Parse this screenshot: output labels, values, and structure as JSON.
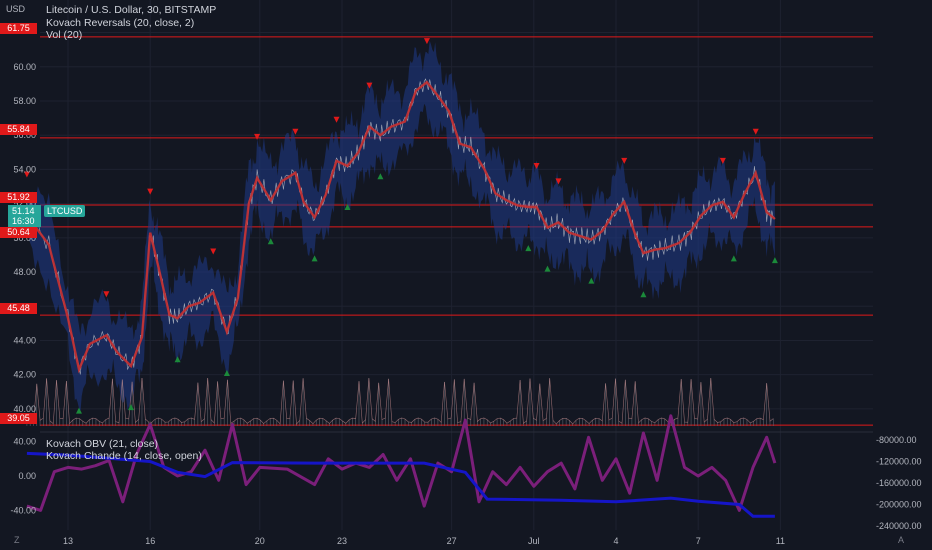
{
  "title": "Litecoin / U.S. Dollar, 30, BITSTAMP",
  "currency": "USD",
  "indicators": [
    "Kovach Reversals (20, close, 2)",
    "Vol (20)"
  ],
  "lower_indicators": [
    "Kovach OBV (21, close)",
    "Kovach Chande (14, close, open)"
  ],
  "symbol_tag": "LTCUSD",
  "last_price": "51.14",
  "countdown": "16:30",
  "horizontal_lines": [
    "61.75",
    "55.84",
    "51.92",
    "50.64",
    "45.48",
    "39.05"
  ],
  "price_axis_ticks": [
    "60.00",
    "58.00",
    "56.00",
    "54.00",
    "52.00",
    "50.00",
    "48.00",
    "46.00",
    "44.00",
    "42.00",
    "40.00"
  ],
  "osc_left_ticks": [
    "40.00",
    "0.00",
    "-40.00"
  ],
  "osc_right_ticks": [
    "-80000.00",
    "-120000.00",
    "-160000.00",
    "-200000.00",
    "-240000.00"
  ],
  "time_ticks": [
    "13",
    "16",
    "20",
    "23",
    "27",
    "Jul",
    "4",
    "7",
    "11"
  ],
  "corner_left": "Z",
  "corner_right": "A",
  "colors": {
    "background": "#131722",
    "hline": "#e0191a",
    "band": "#1f3a8a",
    "ma": "#c83030",
    "up_marker": "#1b8a3a",
    "down_marker": "#e0191a",
    "chande": "#7b1f7a",
    "obv": "#1515c8",
    "symbol_tag": "#26a69a"
  },
  "chart_data": {
    "type": "line",
    "title": "Litecoin / U.S. Dollar, 30, BITSTAMP",
    "ylabel": "USD",
    "ylim": [
      39.0,
      62.5
    ],
    "x": [
      "13",
      "16",
      "20",
      "23",
      "27",
      "Jul",
      "4",
      "7",
      "11"
    ],
    "series": [
      {
        "name": "LTCUSD",
        "points": [
          [
            11.5,
            51.3
          ],
          [
            12.3,
            49.6
          ],
          [
            13.0,
            45.3
          ],
          [
            13.4,
            42.3
          ],
          [
            13.8,
            43.8
          ],
          [
            14.4,
            44.3
          ],
          [
            14.8,
            43.3
          ],
          [
            15.3,
            42.5
          ],
          [
            15.7,
            44.2
          ],
          [
            16.0,
            50.3
          ],
          [
            16.3,
            48.3
          ],
          [
            16.7,
            45.5
          ],
          [
            17.0,
            45.3
          ],
          [
            17.4,
            46.0
          ],
          [
            17.8,
            46.2
          ],
          [
            18.3,
            46.8
          ],
          [
            18.8,
            44.5
          ],
          [
            19.2,
            46.5
          ],
          [
            19.6,
            52.0
          ],
          [
            19.9,
            53.5
          ],
          [
            20.4,
            52.2
          ],
          [
            20.8,
            53.3
          ],
          [
            21.3,
            53.8
          ],
          [
            21.6,
            52.1
          ],
          [
            22.0,
            51.2
          ],
          [
            22.4,
            52.5
          ],
          [
            22.8,
            54.5
          ],
          [
            23.2,
            54.2
          ],
          [
            23.6,
            55.0
          ],
          [
            24.0,
            56.5
          ],
          [
            24.4,
            56.0
          ],
          [
            24.8,
            56.5
          ],
          [
            25.3,
            56.8
          ],
          [
            25.7,
            58.6
          ],
          [
            26.1,
            59.1
          ],
          [
            26.5,
            58.3
          ],
          [
            26.9,
            57.4
          ],
          [
            27.3,
            55.5
          ],
          [
            27.7,
            55.3
          ],
          [
            28.2,
            54.0
          ],
          [
            28.6,
            52.6
          ],
          [
            29.0,
            52.2
          ],
          [
            29.4,
            51.9
          ],
          [
            29.8,
            51.8
          ],
          [
            30.1,
            51.8
          ],
          [
            30.5,
            50.6
          ],
          [
            30.9,
            50.9
          ],
          [
            31.3,
            50.3
          ],
          [
            31.7,
            50.1
          ],
          [
            32.1,
            49.9
          ],
          [
            32.5,
            50.4
          ],
          [
            32.9,
            51.4
          ],
          [
            33.3,
            52.1
          ],
          [
            33.7,
            50.2
          ],
          [
            34.0,
            49.1
          ],
          [
            34.4,
            49.3
          ],
          [
            34.8,
            49.4
          ],
          [
            35.3,
            49.7
          ],
          [
            35.7,
            50.3
          ],
          [
            36.1,
            51.3
          ],
          [
            36.5,
            51.9
          ],
          [
            36.9,
            52.1
          ],
          [
            37.3,
            51.2
          ],
          [
            37.7,
            52.6
          ],
          [
            38.1,
            53.8
          ],
          [
            38.5,
            51.5
          ],
          [
            38.8,
            51.1
          ]
        ]
      },
      {
        "name": "Kovach OBV (21, close)",
        "points": [
          [
            11.5,
            -105000
          ],
          [
            13.0,
            -108000
          ],
          [
            16.0,
            -120000
          ],
          [
            17.0,
            -140000
          ],
          [
            18.0,
            -148000
          ],
          [
            19.0,
            -122000
          ],
          [
            22.0,
            -123000
          ],
          [
            26.0,
            -123000
          ],
          [
            27.5,
            -140000
          ],
          [
            28.3,
            -190000
          ],
          [
            31.0,
            -192000
          ],
          [
            33.0,
            -195000
          ],
          [
            35.0,
            -188000
          ],
          [
            36.0,
            -194000
          ],
          [
            37.5,
            -200000
          ],
          [
            38.0,
            -222000
          ],
          [
            38.8,
            -222000
          ]
        ]
      },
      {
        "name": "Kovach Chande (14, close, open)",
        "points": [
          [
            11.5,
            -35
          ],
          [
            12.0,
            -40
          ],
          [
            12.5,
            5
          ],
          [
            13.0,
            10
          ],
          [
            13.5,
            8
          ],
          [
            14.0,
            12
          ],
          [
            14.5,
            18
          ],
          [
            15.0,
            -30
          ],
          [
            15.5,
            25
          ],
          [
            16.0,
            60
          ],
          [
            16.5,
            10
          ],
          [
            17.0,
            0
          ],
          [
            17.5,
            5
          ],
          [
            18.0,
            30
          ],
          [
            18.5,
            -5
          ],
          [
            19.0,
            60
          ],
          [
            19.5,
            -10
          ],
          [
            20.0,
            10
          ],
          [
            21.0,
            8
          ],
          [
            22.0,
            -10
          ],
          [
            22.5,
            20
          ],
          [
            23.0,
            8
          ],
          [
            23.5,
            15
          ],
          [
            24.0,
            10
          ],
          [
            24.5,
            25
          ],
          [
            25.0,
            -5
          ],
          [
            25.5,
            20
          ],
          [
            26.0,
            -35
          ],
          [
            26.5,
            15
          ],
          [
            27.0,
            5
          ],
          [
            27.5,
            65
          ],
          [
            28.0,
            -30
          ],
          [
            28.5,
            5
          ],
          [
            29.0,
            -10
          ],
          [
            29.5,
            10
          ],
          [
            30.0,
            -12
          ],
          [
            30.5,
            5
          ],
          [
            31.0,
            15
          ],
          [
            31.5,
            -15
          ],
          [
            32.0,
            45
          ],
          [
            32.5,
            -5
          ],
          [
            33.0,
            20
          ],
          [
            33.5,
            -20
          ],
          [
            34.0,
            50
          ],
          [
            34.5,
            -5
          ],
          [
            35.0,
            70
          ],
          [
            35.5,
            10
          ],
          [
            36.0,
            0
          ],
          [
            36.5,
            10
          ],
          [
            37.0,
            -5
          ],
          [
            37.5,
            -40
          ],
          [
            38.0,
            10
          ],
          [
            38.5,
            45
          ],
          [
            38.8,
            15
          ]
        ]
      }
    ],
    "levels": [
      61.75,
      55.84,
      51.92,
      50.64,
      45.48,
      39.05
    ]
  }
}
